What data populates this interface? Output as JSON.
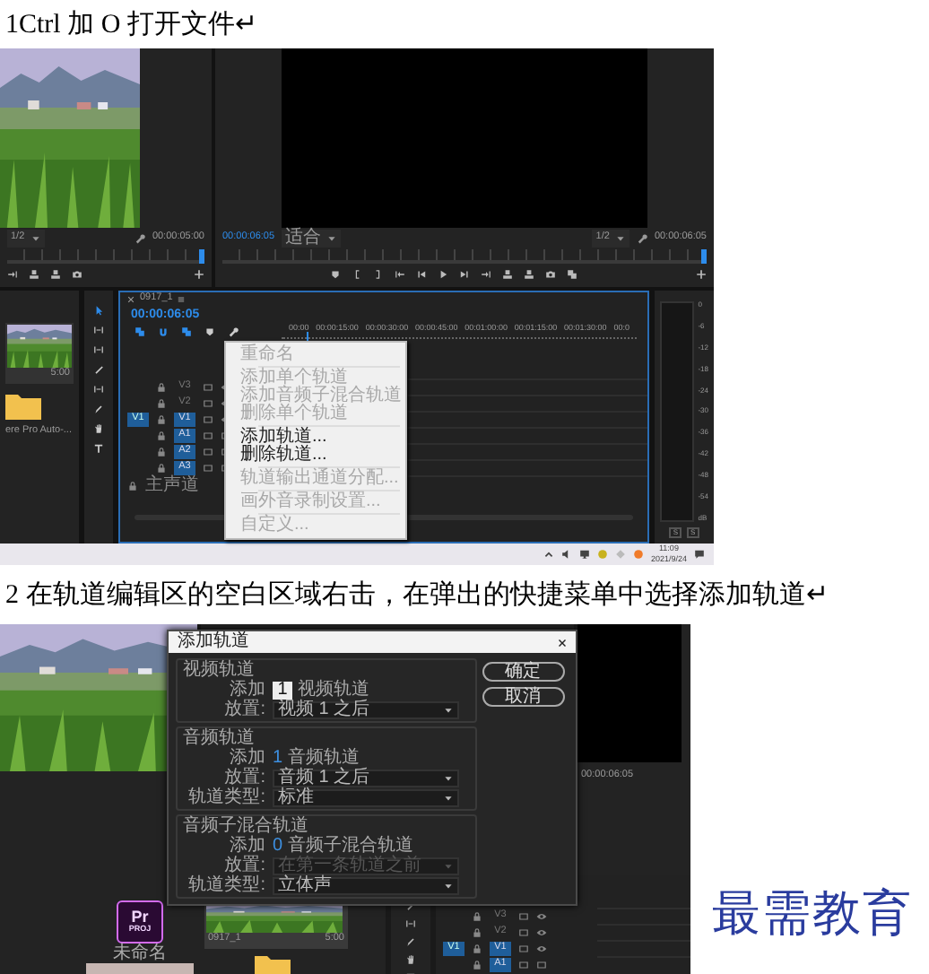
{
  "step_1": {
    "caption": "1Ctrl 加 O 打开文件↵",
    "screenshot": {
      "source_monitor": {
        "zoom": "1/2",
        "timecode": "00:00:05:00"
      },
      "program_monitor": {
        "timecode": "00:00:06:05",
        "fit": "适合",
        "zoom": "1/2",
        "duration": "00:00:06:05"
      },
      "project_panel": {
        "clip_duration": "5:00",
        "item_label": "ere Pro Auto-..."
      },
      "timeline": {
        "sequence_tab": "0917_1",
        "timecode": "00:00:06:05",
        "ruler": [
          "00:00",
          "00:00:15:00",
          "00:00:30:00",
          "00:00:45:00",
          "00:01:00:00",
          "00:01:15:00",
          "00:01:30:00",
          "00:0"
        ],
        "tracks": [
          {
            "name": "V3",
            "kind": "video",
            "targeted": false
          },
          {
            "name": "V2",
            "kind": "video",
            "targeted": false
          },
          {
            "name": "V1",
            "kind": "video",
            "targeted": true,
            "source": "V1"
          },
          {
            "name": "A1",
            "kind": "audio",
            "targeted": true
          },
          {
            "name": "A2",
            "kind": "audio",
            "targeted": true
          },
          {
            "name": "A3",
            "kind": "audio",
            "targeted": true
          },
          {
            "name": "主声道",
            "kind": "master"
          }
        ]
      },
      "context_menu": {
        "groups": [
          {
            "items": [
              {
                "label": "重命名",
                "disabled": true
              }
            ]
          },
          {
            "items": [
              {
                "label": "添加单个轨道",
                "disabled": true
              },
              {
                "label": "添加音频子混合轨道",
                "disabled": true
              },
              {
                "label": "删除单个轨道",
                "disabled": true
              }
            ]
          },
          {
            "items": [
              {
                "label": "添加轨道...",
                "disabled": false
              },
              {
                "label": "删除轨道...",
                "disabled": false
              }
            ]
          },
          {
            "items": [
              {
                "label": "轨道输出通道分配...",
                "disabled": true
              }
            ]
          },
          {
            "items": [
              {
                "label": "画外音录制设置...",
                "disabled": true
              }
            ]
          },
          {
            "items": [
              {
                "label": "自定义...",
                "disabled": true
              }
            ]
          }
        ]
      },
      "audio_meter": {
        "scale": [
          "0",
          "-6",
          "-12",
          "-18",
          "-24",
          "-30",
          "-36",
          "-42",
          "-48",
          "-54",
          "dB"
        ],
        "solo_buttons": [
          "S",
          "S"
        ]
      },
      "taskbar": {
        "time": "11:09",
        "date": "2021/9/24"
      }
    }
  },
  "step_2": {
    "caption": "2 在轨道编辑区的空白区域右击，在弹出的快捷菜单中选择添加轨道↵",
    "screenshot": {
      "program_monitor": {
        "timecode": "00:00:06:05"
      },
      "dialog": {
        "title": "添加轨道",
        "sections": [
          {
            "heading": "视频轨道",
            "rows": [
              {
                "kind": "count",
                "label": "添加",
                "value": "1",
                "editing": true,
                "suffix": "视频轨道"
              },
              {
                "kind": "select",
                "label": "放置:",
                "value": "视频 1 之后",
                "disabled": false
              }
            ]
          },
          {
            "heading": "音频轨道",
            "rows": [
              {
                "kind": "count",
                "label": "添加",
                "value": "1",
                "editing": false,
                "suffix": "音频轨道"
              },
              {
                "kind": "select",
                "label": "放置:",
                "value": "音频 1 之后",
                "disabled": false
              },
              {
                "kind": "select",
                "label": "轨道类型:",
                "value": "标准",
                "disabled": false
              }
            ]
          },
          {
            "heading": "音频子混合轨道",
            "rows": [
              {
                "kind": "count",
                "label": "添加",
                "value": "0",
                "editing": false,
                "suffix": "音频子混合轨道"
              },
              {
                "kind": "select",
                "label": "放置:",
                "value": "在第一条轨道之前",
                "disabled": true
              },
              {
                "kind": "select",
                "label": "轨道类型:",
                "value": "立体声",
                "disabled": false
              }
            ]
          }
        ],
        "buttons": [
          "确定",
          "取消"
        ]
      },
      "project_panel": {
        "app_initials": "Pr",
        "file_type": "PROJ",
        "project_name": "未命名",
        "clip_name": "0917_1",
        "clip_duration": "5:00"
      },
      "timeline": {
        "tracks": [
          {
            "name": "V3",
            "kind": "video",
            "targeted": false
          },
          {
            "name": "V2",
            "kind": "video",
            "targeted": false
          },
          {
            "name": "V1",
            "kind": "video",
            "targeted": true,
            "source": "V1"
          },
          {
            "name": "A1",
            "kind": "audio",
            "targeted": true
          }
        ]
      }
    }
  },
  "logo": "最需教育"
}
